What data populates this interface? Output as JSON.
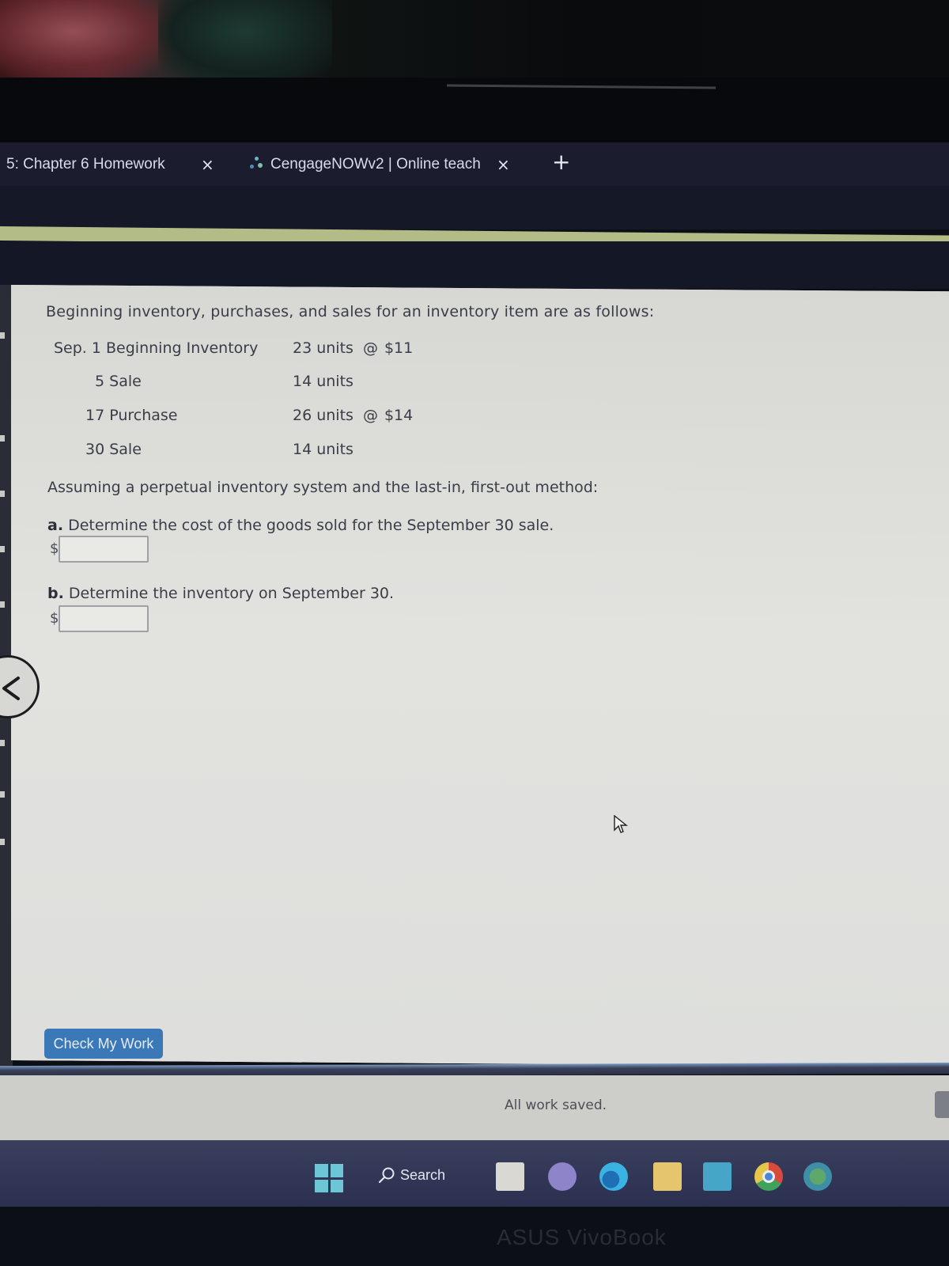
{
  "browser": {
    "tabs": [
      {
        "label": "5: Chapter 6 Homework",
        "active": false
      },
      {
        "label": "CengageNOWv2 | Online teach",
        "active": true
      }
    ],
    "new_tab_label": "+",
    "close_glyph": "×"
  },
  "problem": {
    "intro": "Beginning inventory, purchases, and sales for an inventory item are as follows:",
    "rows": [
      {
        "date": "Sep. 1 Beginning Inventory",
        "quantity": "23 units",
        "at": "@",
        "price": "$11"
      },
      {
        "date": "5 Sale",
        "quantity": "14 units",
        "at": "",
        "price": ""
      },
      {
        "date": "17 Purchase",
        "quantity": "26 units",
        "at": "@",
        "price": "$14"
      },
      {
        "date": "30 Sale",
        "quantity": "14 units",
        "at": "",
        "price": ""
      }
    ],
    "assumption": "Assuming a perpetual inventory system and the last-in, first-out method:",
    "questions": [
      {
        "letter": "a.",
        "text": "Determine the cost of the goods sold for the September 30 sale.",
        "currency": "$",
        "value": ""
      },
      {
        "letter": "b.",
        "text": "Determine the inventory on September 30.",
        "currency": "$",
        "value": ""
      }
    ]
  },
  "actions": {
    "check_my_work": "Check My Work"
  },
  "footer": {
    "status": "All work saved."
  },
  "taskbar": {
    "search_label": "Search",
    "apps": [
      "task-view",
      "chat",
      "edge",
      "file-explorer",
      "mail",
      "chrome",
      "other-app"
    ]
  },
  "device": {
    "brand": "ASUS VivoBook"
  },
  "colors": {
    "accent_bar": "#b3bc87",
    "button": "#3b78b8",
    "tabstrip": "#1b1d2e",
    "taskbar": "#2c3150"
  }
}
